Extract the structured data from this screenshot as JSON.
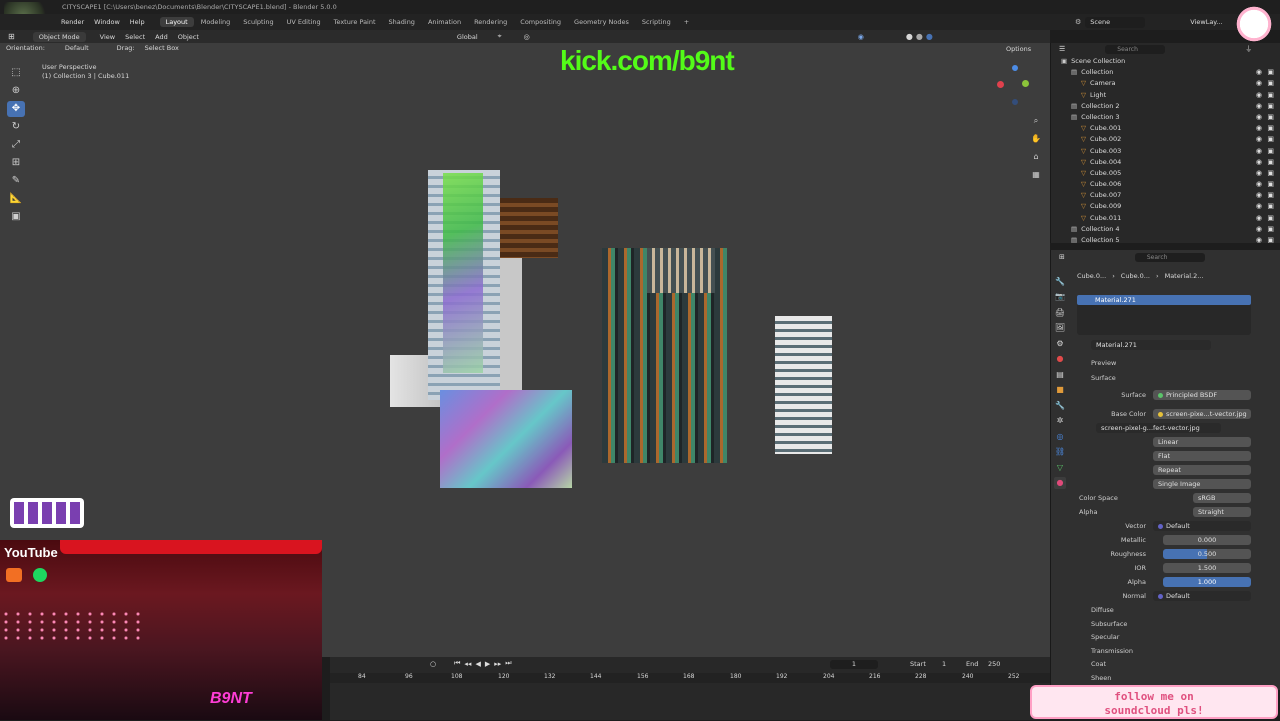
{
  "window": {
    "title": "CITYSCAPE1 [C:\\Users\\benez\\Documents\\Blender\\CITYSCAPE1.blend] - Blender 5.0.0"
  },
  "menu": {
    "items": [
      "Render",
      "Window",
      "Help"
    ]
  },
  "workspaces": [
    "Layout",
    "Modeling",
    "Sculpting",
    "UV Editing",
    "Texture Paint",
    "Shading",
    "Animation",
    "Rendering",
    "Compositing",
    "Geometry Nodes",
    "Scripting"
  ],
  "scene": {
    "label": "Scene",
    "view_layer": "ViewLay..."
  },
  "viewport_header": {
    "mode": "Object Mode",
    "view": "View",
    "select": "Select",
    "add": "Add",
    "object": "Object",
    "transform": "Global",
    "orientation_label": "Orientation:",
    "orientation_value": "Default",
    "drag_label": "Drag:",
    "drag_value": "Select Box",
    "options": "Options"
  },
  "viewport": {
    "perspective": "User Perspective",
    "collection_info": "(1) Collection 3 | Cube.011",
    "overlay_url": "kick.com/b9nt"
  },
  "outliner": {
    "search_placeholder": "Search",
    "items": [
      {
        "label": "Scene Collection",
        "indent": 0
      },
      {
        "label": "Collection",
        "indent": 1
      },
      {
        "label": "Camera",
        "indent": 2
      },
      {
        "label": "Light",
        "indent": 2
      },
      {
        "label": "Collection 2",
        "indent": 1
      },
      {
        "label": "Collection 3",
        "indent": 1
      },
      {
        "label": "Cube.001",
        "indent": 2
      },
      {
        "label": "Cube.002",
        "indent": 2
      },
      {
        "label": "Cube.003",
        "indent": 2
      },
      {
        "label": "Cube.004",
        "indent": 2
      },
      {
        "label": "Cube.005",
        "indent": 2
      },
      {
        "label": "Cube.006",
        "indent": 2
      },
      {
        "label": "Cube.007",
        "indent": 2
      },
      {
        "label": "Cube.009",
        "indent": 2
      },
      {
        "label": "Cube.011",
        "indent": 2
      },
      {
        "label": "Collection 4",
        "indent": 1
      },
      {
        "label": "Collection 5",
        "indent": 1
      }
    ]
  },
  "properties": {
    "search_placeholder": "Search",
    "breadcrumb": [
      "Cube.0...",
      "Cube.0...",
      "Material.2..."
    ],
    "slot": "Material.271",
    "material_name": "Material.271",
    "preview": "Preview",
    "surface": "Surface",
    "surface_label": "Surface",
    "surface_value": "Principled BSDF",
    "base_color_label": "Base Color",
    "base_color_value": "screen-pixe...t-vector.jpg",
    "image_name": "screen-pixel-g...fect-vector.jpg",
    "interp": "Linear",
    "projection": "Flat",
    "extension": "Repeat",
    "source": "Single Image",
    "color_space_label": "Color Space",
    "color_space": "sRGB",
    "alpha_mode_label": "Alpha",
    "alpha_mode": "Straight",
    "vector_label": "Vector",
    "vector": "Default",
    "metallic_label": "Metallic",
    "metallic": "0.000",
    "roughness_label": "Roughness",
    "roughness": "0.500",
    "ior_label": "IOR",
    "ior": "1.500",
    "alpha_label": "Alpha",
    "alpha": "1.000",
    "normal_label": "Normal",
    "normal": "Default",
    "sections": [
      "Diffuse",
      "Subsurface",
      "Specular",
      "Transmission",
      "Coat",
      "Sheen"
    ]
  },
  "timeline": {
    "frame": "1",
    "start_label": "Start",
    "start": "1",
    "end_label": "End",
    "end": "250",
    "ticks": [
      "84",
      "96",
      "108",
      "120",
      "132",
      "144",
      "156",
      "168",
      "180",
      "192",
      "204",
      "216",
      "228",
      "240",
      "252"
    ]
  },
  "overlays": {
    "youtube": "YouTube",
    "soundcloud_banner": "follow me on soundcloud pls!",
    "signature": "B9NT"
  },
  "colors": {
    "accent": "#4772b3",
    "kick_green": "#53fc18",
    "viewport": "#3d3d3d"
  }
}
